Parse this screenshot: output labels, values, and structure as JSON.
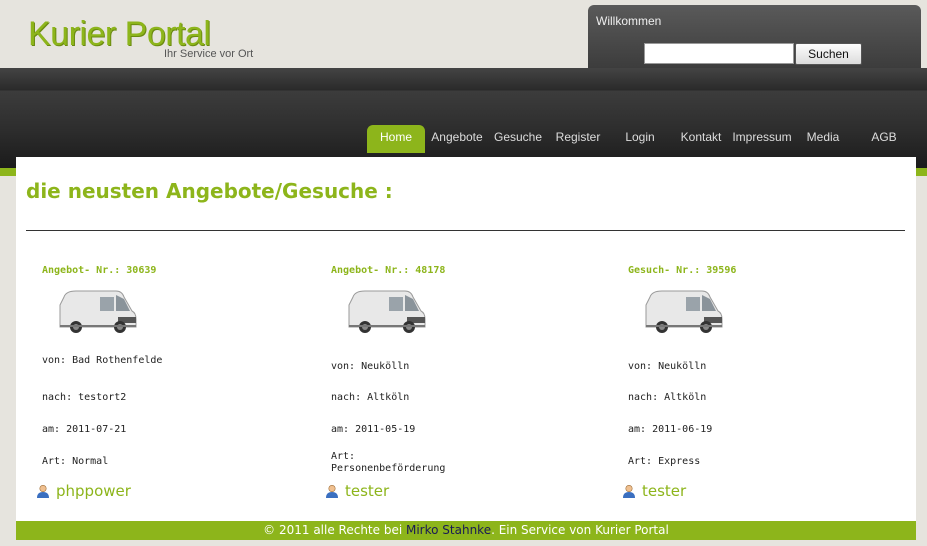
{
  "logo": {
    "title": "Kurier Portal",
    "subtitle": "Ihr Service vor Ort"
  },
  "login": {
    "welcome": "Willkommen",
    "search_value": "",
    "search_button": "Suchen"
  },
  "nav": [
    {
      "label": "Home",
      "active": true
    },
    {
      "label": "Angebote"
    },
    {
      "label": "Gesuche"
    },
    {
      "label": "Register"
    },
    {
      "label": "Login"
    },
    {
      "label": "Kontakt"
    },
    {
      "label": "Impressum"
    },
    {
      "label": "Media"
    },
    {
      "label": "AGB"
    }
  ],
  "main": {
    "title": "die neusten Angebote/Gesuche :",
    "cards": [
      {
        "title": "Angebot- Nr.: 30639",
        "von": "von: Bad Rothenfelde",
        "nach": "nach: testort2",
        "am": "am: 2011-07-21",
        "art": "Art: Normal",
        "user": "phppower"
      },
      {
        "title": "Angebot- Nr.: 48178",
        "von": "von: Neukölln",
        "nach": "nach: Altköln",
        "am": "am: 2011-05-19",
        "art": "Art: Personenbeförderung",
        "user": "tester"
      },
      {
        "title": "Gesuch- Nr.: 39596",
        "von": "von: Neukölln",
        "nach": "nach: Altköln",
        "am": "am: 2011-06-19",
        "art": "Art: Express",
        "user": "tester"
      }
    ]
  },
  "footer": {
    "prefix": "© 2011 alle Rechte bei ",
    "link": "Mirko Stahnke",
    "suffix": ". Ein Service von Kurier Portal"
  },
  "colors": {
    "accent": "#8db51b",
    "dark": "#2a2a2a"
  },
  "icons": {
    "vehicle": "van-icon",
    "user": "user-icon"
  }
}
